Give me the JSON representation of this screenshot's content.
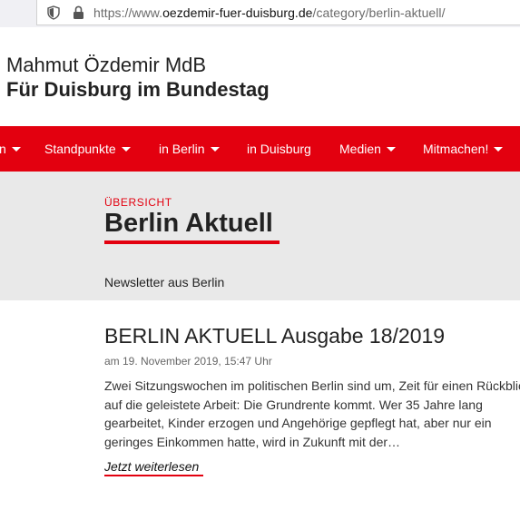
{
  "browser": {
    "url_prefix": "https://www.",
    "url_host": "oezdemir-fuer-duisburg.de",
    "url_path": "/category/berlin-aktuell/"
  },
  "site": {
    "title": "Mahmut Özdemir MdB",
    "subtitle": "Für Duisburg im Bundestag"
  },
  "nav": {
    "items": [
      {
        "label": "n",
        "has_dropdown": true
      },
      {
        "label": "Standpunkte",
        "has_dropdown": true
      },
      {
        "label": "in Berlin",
        "has_dropdown": true
      },
      {
        "label": "in Duisburg",
        "has_dropdown": false
      },
      {
        "label": "Medien",
        "has_dropdown": true
      },
      {
        "label": "Mitmachen!",
        "has_dropdown": true
      }
    ]
  },
  "hero": {
    "kicker": "ÜBERSICHT",
    "title": "Berlin Aktuell",
    "description": "Newsletter aus Berlin"
  },
  "article": {
    "title": "BERLIN AKTUELL Ausgabe 18/2019",
    "meta": "am 19. November 2019, 15:47 Uhr",
    "excerpt": "Zwei Sitzungswochen im politischen Berlin sind um, Zeit für einen Rückblick auf die geleistete Arbeit: Die Grundrente kommt. Wer 35 Jahre lang gearbeitet, Kinder erzogen und Angehörige gepflegt hat, aber nur ein geringes Einkommen hatte, wird in Zukunft mit der…",
    "read_more": "Jetzt weiterlesen"
  },
  "colors": {
    "accent": "#e3000f",
    "hero_bg": "#e9e9e9"
  }
}
